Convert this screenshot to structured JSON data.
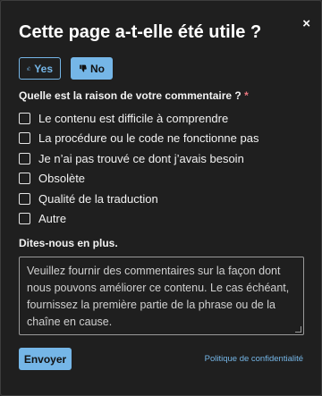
{
  "dialog": {
    "title": "Cette page a-t-elle été utile ?",
    "close_label": "×"
  },
  "vote": {
    "yes_label": "Yes",
    "no_label": "No",
    "yes_icon": "thumbs-up-icon",
    "no_icon": "thumbs-down-icon",
    "selected": "No"
  },
  "reason": {
    "question": "Quelle est la raison de votre commentaire ?",
    "required_mark": "*",
    "options": [
      {
        "label": "Le contenu est difficile à comprendre",
        "checked": false
      },
      {
        "label": "La procédure ou le code ne fonctionne pas",
        "checked": false
      },
      {
        "label": "Je n’ai pas trouvé ce dont j’avais besoin",
        "checked": false
      },
      {
        "label": "Obsolète",
        "checked": false
      },
      {
        "label": "Qualité de la traduction",
        "checked": false
      },
      {
        "label": "Autre",
        "checked": false
      }
    ]
  },
  "details": {
    "label": "Dites-nous en plus.",
    "placeholder": "Veuillez fournir des commentaires sur la façon dont nous pouvons améliorer ce contenu. Le cas échéant, fournissez la première partie de la phrase ou de la chaîne en cause.",
    "value": ""
  },
  "footer": {
    "submit_label": "Envoyer",
    "privacy_label": "Politique de confidentialité"
  },
  "colors": {
    "accent": "#75b6e7",
    "dialog_bg": "#1f1f1f",
    "required": "#e8757e"
  }
}
